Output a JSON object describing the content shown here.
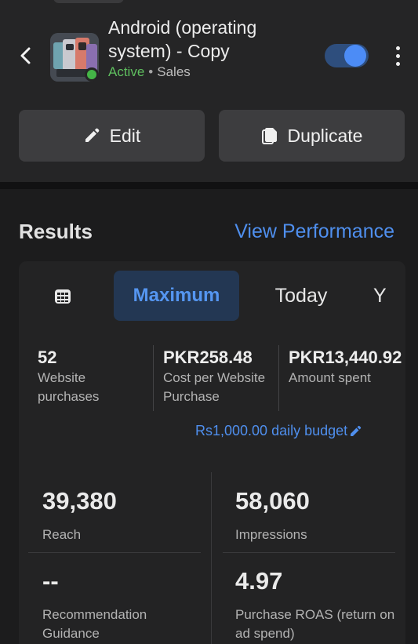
{
  "header": {
    "title": "Android (operating system) - Copy",
    "status": "Active",
    "separator": "•",
    "objective": "Sales",
    "delivery_toggle_on": true
  },
  "actions": {
    "edit_label": "Edit",
    "duplicate_label": "Duplicate"
  },
  "results": {
    "title": "Results",
    "view_performance": "View Performance"
  },
  "date_tabs": {
    "selected": "Maximum",
    "items": [
      "Maximum",
      "Today",
      "Y"
    ]
  },
  "summary": [
    {
      "value": "52",
      "label": "Website purchases"
    },
    {
      "value": "PKR258.48",
      "label": "Cost per Website Purchase"
    },
    {
      "value": "PKR13,440.92",
      "label": "Amount spent"
    }
  ],
  "budget": {
    "label": "Rs1,000.00 daily budget"
  },
  "metrics": [
    {
      "value": "39,380",
      "label": "Reach"
    },
    {
      "value": "58,060",
      "label": "Impressions"
    },
    {
      "value": "--",
      "label": "Recommendation Guidance"
    },
    {
      "value": "4.97",
      "label": "Purchase ROAS (return on ad spend)"
    }
  ],
  "colors": {
    "accent": "#4f8fee",
    "active_green": "#5fbf5f",
    "toggle_knob": "#4c8cf6",
    "background": "#1c1c1d"
  },
  "icons": [
    "back-arrow-icon",
    "more-vertical-icon",
    "pencil-icon",
    "copy-icon",
    "calendar-grid-icon",
    "edit-pencil-icon"
  ]
}
